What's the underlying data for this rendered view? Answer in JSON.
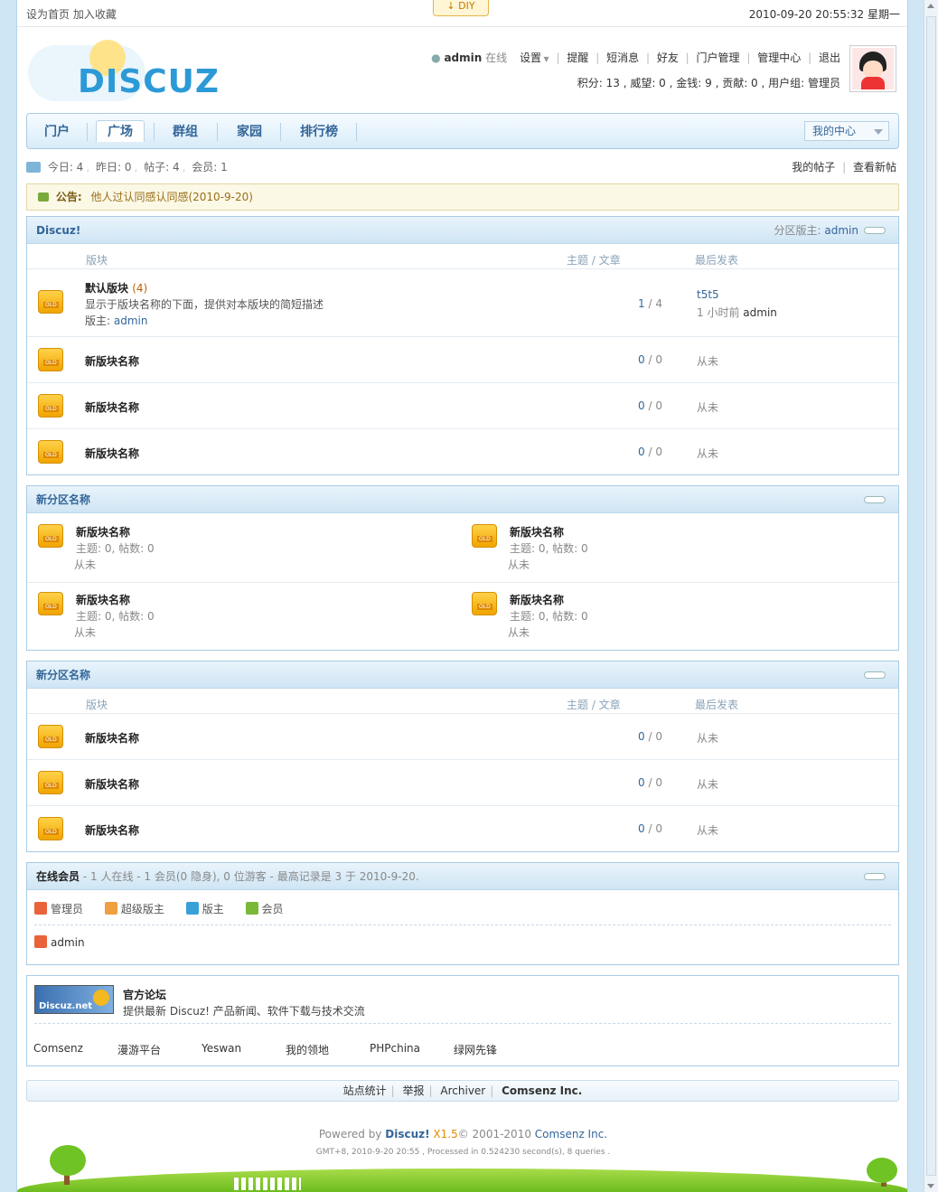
{
  "topbar": {
    "set_home": "设为首页",
    "add_fav": "加入收藏",
    "diy": "DIY",
    "datetime": "2010-09-20 20:55:32 星期一"
  },
  "logo": {
    "text": "DISCUZ"
  },
  "user": {
    "name": "admin",
    "status": "在线",
    "menu": [
      "设置",
      "提醒",
      "短消息",
      "好友",
      "门户管理",
      "管理中心",
      "退出"
    ],
    "stats": "积分: 13 , 威望: 0 , 金钱: 9 , 贡献: 0 , 用户组: 管理员"
  },
  "nav": {
    "items": [
      "门户",
      "广场",
      "群组",
      "家园",
      "排行榜"
    ],
    "active": "广场",
    "mycenter": "我的中心"
  },
  "stats": {
    "today": "今日: 4",
    "yesterday": "昨日: 0",
    "posts": "帖子: 4",
    "members": "会员: 1",
    "my_posts": "我的帖子",
    "new_posts": "查看新帖"
  },
  "notice": {
    "label": "公告:",
    "text": "他人过认同感认同感(2010-9-20)"
  },
  "category1": {
    "title": "Discuz!",
    "moderator_label": "分区版主:",
    "moderator": "admin",
    "col_forum": "版块",
    "col_threads": "主题 / 文章",
    "col_last": "最后发表",
    "forums": [
      {
        "name": "默认版块",
        "today": "(4)",
        "desc": "显示于版块名称的下面，提供对本版块的简短描述",
        "mod_label": "版主:",
        "mod": "admin",
        "threads": "1",
        "posts": "4",
        "last_title": "t5t5",
        "last_time": "1 小时前",
        "last_user": "admin"
      },
      {
        "name": "新版块名称",
        "threads": "0",
        "posts": "0",
        "last": "从未"
      },
      {
        "name": "新版块名称",
        "threads": "0",
        "posts": "0",
        "last": "从未"
      },
      {
        "name": "新版块名称",
        "threads": "0",
        "posts": "0",
        "last": "从未"
      }
    ]
  },
  "category2": {
    "title": "新分区名称",
    "forums": [
      {
        "name": "新版块名称",
        "info": "主题: 0, 帖数: 0",
        "last": "从未"
      },
      {
        "name": "新版块名称",
        "info": "主题: 0, 帖数: 0",
        "last": "从未"
      },
      {
        "name": "新版块名称",
        "info": "主题: 0, 帖数: 0",
        "last": "从未"
      },
      {
        "name": "新版块名称",
        "info": "主题: 0, 帖数: 0",
        "last": "从未"
      }
    ]
  },
  "category3": {
    "title": "新分区名称",
    "col_forum": "版块",
    "col_threads": "主题 / 文章",
    "col_last": "最后发表",
    "forums": [
      {
        "name": "新版块名称",
        "threads": "0",
        "posts": "0",
        "last": "从未"
      },
      {
        "name": "新版块名称",
        "threads": "0",
        "posts": "0",
        "last": "从未"
      },
      {
        "name": "新版块名称",
        "threads": "0",
        "posts": "0",
        "last": "从未"
      }
    ]
  },
  "online": {
    "title": "在线会员",
    "summary": "- 1 人在线 - 1 会员(0 隐身), 0 位游客 - 最高记录是 3 于 2010-9-20.",
    "legend": [
      {
        "label": "管理员",
        "color": "#e8623a"
      },
      {
        "label": "超级版主",
        "color": "#f0a040"
      },
      {
        "label": "版主",
        "color": "#3aa0d8"
      },
      {
        "label": "会员",
        "color": "#7ab83a"
      }
    ],
    "users": [
      "admin"
    ]
  },
  "links": {
    "banner_text": "Discuz.net",
    "official_title": "官方论坛",
    "official_desc": "提供最新 Discuz! 产品新闻、软件下载与技术交流",
    "items": [
      "Comsenz",
      "漫游平台",
      "Yeswan",
      "我的领地",
      "PHPchina",
      "绿网先锋"
    ]
  },
  "footer": {
    "links": [
      "站点统计",
      "举报",
      "Archiver"
    ],
    "company": "Comsenz Inc.",
    "powered_by": "Powered by",
    "product": "Discuz!",
    "version": "X1.5",
    "copyright": "© 2001-2010",
    "company_link": "Comsenz Inc.",
    "gmt": "GMT+8, 2010-9-20 20:55 , Processed in 0.524230 second(s), 8 queries ."
  }
}
